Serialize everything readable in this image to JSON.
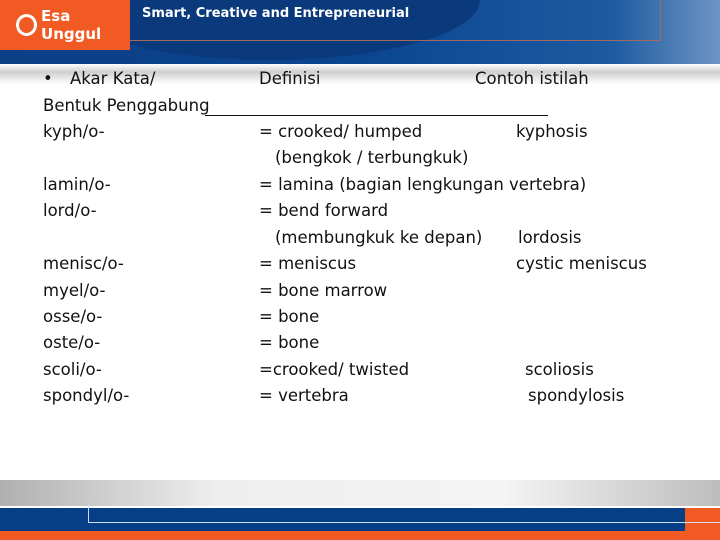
{
  "header": {
    "logo_text": "Esa Unggul",
    "tagline": "Smart, Creative and Entrepreneurial"
  },
  "content": {
    "headers": {
      "bullet": "•",
      "root": "Akar Kata/",
      "root2": "Bentuk Penggabung",
      "definition": "Definisi",
      "example": "Contoh istilah"
    },
    "rows": [
      {
        "root": "kyph/o-",
        "definition": "= crooked/ humped",
        "example": "kyphosis"
      },
      {
        "root": "",
        "definition": "(bengkok / terbungkuk)",
        "example": ""
      },
      {
        "root": "lamin/o-",
        "definition": "= lamina (bagian lengkungan vertebra)",
        "example": ""
      },
      {
        "root": "lord/o-",
        "definition": "= bend forward",
        "example": ""
      },
      {
        "root": "",
        "definition": "(membungkuk ke depan)",
        "example": "lordosis"
      },
      {
        "root": "menisc/o-",
        "definition": "= meniscus",
        "example": "cystic meniscus"
      },
      {
        "root": "myel/o-",
        "definition": "= bone marrow",
        "example": ""
      },
      {
        "root": "osse/o-",
        "definition": "= bone",
        "example": ""
      },
      {
        "root": "oste/o-",
        "definition": "= bone",
        "example": ""
      },
      {
        "root": "scoli/o-",
        "definition": "=crooked/ twisted",
        "example": "scoliosis"
      },
      {
        "root": "spondyl/o-",
        "definition": "= vertebra",
        "example": "spondylosis"
      }
    ]
  }
}
